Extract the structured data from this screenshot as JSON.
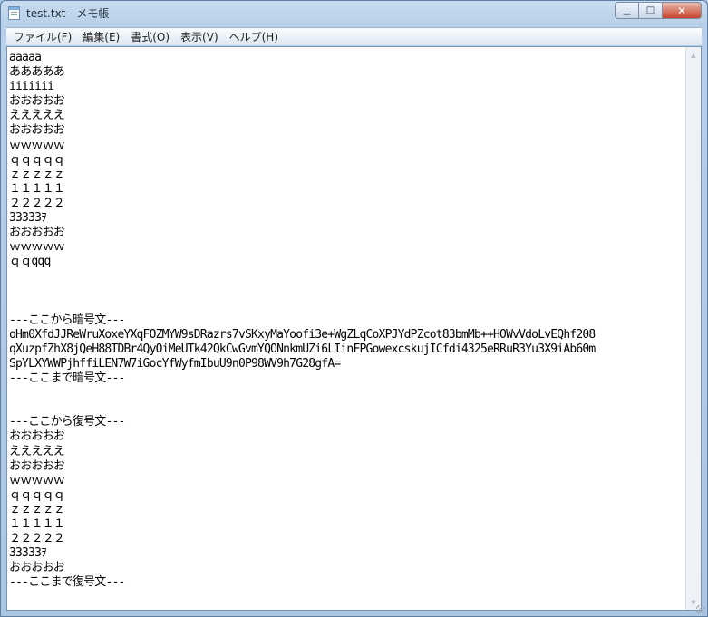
{
  "window": {
    "title": "test.txt - メモ帳",
    "min_label": "▁",
    "max_label": "□",
    "close_label": "✕"
  },
  "menu": [
    "ファイル(F)",
    "編集(E)",
    "書式(O)",
    "表示(V)",
    "ヘルプ(H)"
  ],
  "document": {
    "lines": [
      "aaaaa",
      "あああああ",
      "iiiiiii",
      "おおおおお",
      "えええええ",
      "おおおおお",
      "ｗｗｗｗｗ",
      "ｑｑｑｑｑ",
      "ｚｚｚｚｚ",
      "１１１１１",
      "２２２２２",
      "33333ｦ",
      "おおおおお",
      "ｗｗｗｗｗ",
      "ｑｑqqq",
      "",
      "",
      "",
      "---ここから暗号文---",
      "oHm0XfdJJReWruXoxeYXqFOZMYW9sDRazrs7vSKxyMaYoofi3e+WgZLqCoXPJYdPZcot83bmMb++HOWvVdoLvEQhf208",
      "qXuzpfZhX8jQeH88TDBr4QyOiMeUTk42QkCwGvmYQONnkmUZi6LIinFPGowexcskujICfdi4325eRRuR3Yu3X9iAb60m",
      "SpYLXYWWPjhffiLEN7W7iGocYfWyfmIbuU9n0P98WV9h7G28gfA=",
      "---ここまで暗号文---",
      "",
      "",
      "---ここから復号文---",
      "おおおおお",
      "えええええ",
      "おおおおお",
      "ｗｗｗｗｗ",
      "ｑｑｑｑｑ",
      "ｚｚｚｚｚ",
      "１１１１１",
      "２２２２２",
      "33333ｦ",
      "おおおおお",
      "---ここまで復号文---"
    ]
  },
  "scrollbar": {
    "up_icon": "▲",
    "down_icon": "▼"
  }
}
